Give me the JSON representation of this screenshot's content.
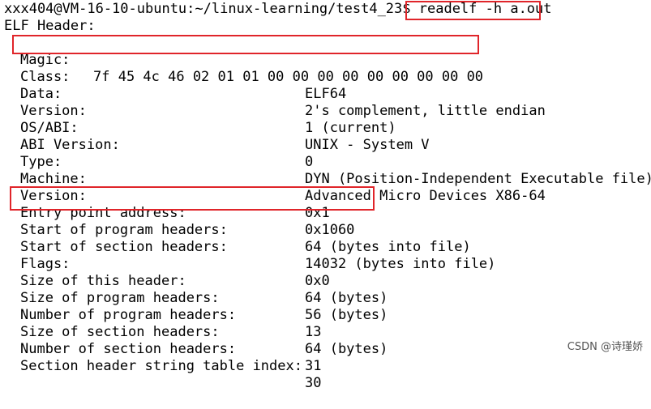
{
  "prompt": {
    "user_host_path": "xxx404@VM-16-10-ubuntu:~/linux-learning/test4_23$ ",
    "command": "readelf -h a.out"
  },
  "elf_header_title": "ELF Header:",
  "magic": {
    "label": "Magic:",
    "bytes": "7f 45 4c 46 02 01 01 00 00 00 00 00 00 00 00 00"
  },
  "fields": [
    {
      "label": "Class:",
      "value": "ELF64"
    },
    {
      "label": "Data:",
      "value": "2's complement, little endian"
    },
    {
      "label": "Version:",
      "value": "1 (current)"
    },
    {
      "label": "OS/ABI:",
      "value": "UNIX - System V"
    },
    {
      "label": "ABI Version:",
      "value": "0"
    },
    {
      "label": "Type:",
      "value": "DYN (Position-Independent Executable file)"
    },
    {
      "label": "Machine:",
      "value": "Advanced Micro Devices X86-64"
    },
    {
      "label": "Version:",
      "value": "0x1"
    },
    {
      "label": "Entry point address:",
      "value": "0x1060"
    },
    {
      "label": "Start of program headers:",
      "value": "64 (bytes into file)"
    },
    {
      "label": "Start of section headers:",
      "value": "14032 (bytes into file)"
    },
    {
      "label": "Flags:",
      "value": "0x0"
    },
    {
      "label": "Size of this header:",
      "value": "64 (bytes)"
    },
    {
      "label": "Size of program headers:",
      "value": "56 (bytes)"
    },
    {
      "label": "Number of program headers:",
      "value": "13"
    },
    {
      "label": "Size of section headers:",
      "value": "64 (bytes)"
    },
    {
      "label": "Number of section headers:",
      "value": "31"
    },
    {
      "label": "Section header string table index:",
      "value": "30"
    }
  ],
  "watermark": "CSDN @诗瑾娇",
  "colors": {
    "highlight_box": "#e0252a",
    "text": "#000000",
    "background": "#ffffff"
  }
}
